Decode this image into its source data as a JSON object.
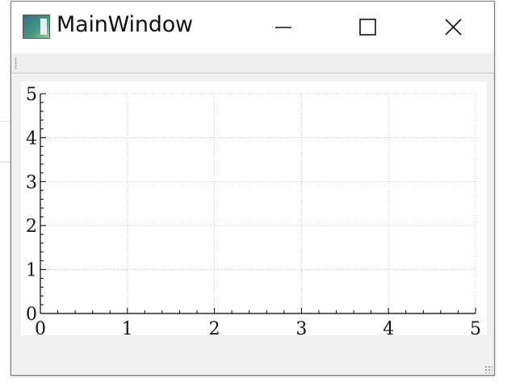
{
  "window": {
    "title": "MainWindow",
    "icon": "app-window-icon",
    "controls": {
      "minimize": "minimize-icon",
      "maximize": "maximize-icon",
      "close": "close-icon"
    }
  },
  "chart_data": {
    "type": "line",
    "title": "",
    "xlabel": "",
    "ylabel": "",
    "xlim": [
      0,
      5
    ],
    "ylim": [
      0,
      5
    ],
    "x_ticks": [
      "0",
      "1",
      "2",
      "3",
      "4",
      "5"
    ],
    "y_ticks": [
      "0",
      "1",
      "2",
      "3",
      "4",
      "5"
    ],
    "grid": true,
    "grid_style": "dotted",
    "series": []
  }
}
